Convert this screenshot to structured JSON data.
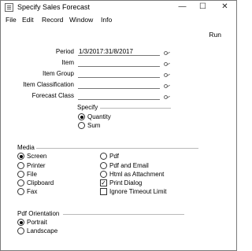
{
  "window": {
    "title": "Specify Sales Forecast",
    "controls": {
      "minimize": "—",
      "maximize": "☐",
      "close": "✕"
    }
  },
  "menubar": {
    "file": "File",
    "edit": "Edit",
    "record": "Record",
    "window": "Window",
    "info": "Info"
  },
  "toolbar": {
    "run": "Run"
  },
  "form": {
    "period": {
      "label": "Period",
      "value": "1/3/2017:31/8/2017"
    },
    "item": {
      "label": "Item",
      "value": ""
    },
    "item_group": {
      "label": "Item Group",
      "value": ""
    },
    "item_classification": {
      "label": "Item Classification",
      "value": ""
    },
    "forecast_class": {
      "label": "Forecast Class",
      "value": ""
    }
  },
  "specify": {
    "title": "Specify",
    "options": [
      {
        "label": "Quantity",
        "selected": true
      },
      {
        "label": "Sum",
        "selected": false
      }
    ]
  },
  "media": {
    "title": "Media",
    "left": [
      {
        "label": "Screen",
        "selected": true
      },
      {
        "label": "Printer",
        "selected": false
      },
      {
        "label": "File",
        "selected": false
      },
      {
        "label": "Clipboard",
        "selected": false
      },
      {
        "label": "Fax",
        "selected": false
      }
    ],
    "right": [
      {
        "label": "Pdf",
        "selected": false
      },
      {
        "label": "Pdf and Email",
        "selected": false
      },
      {
        "label": "Html as Attachment",
        "selected": false
      }
    ],
    "checks": [
      {
        "label": "Print Dialog",
        "checked": true
      },
      {
        "label": "Ignore Timeout Limit",
        "checked": false
      }
    ]
  },
  "pdf_orientation": {
    "title": "Pdf Orientation",
    "options": [
      {
        "label": "Portrait",
        "selected": true
      },
      {
        "label": "Landscape",
        "selected": false
      }
    ]
  }
}
